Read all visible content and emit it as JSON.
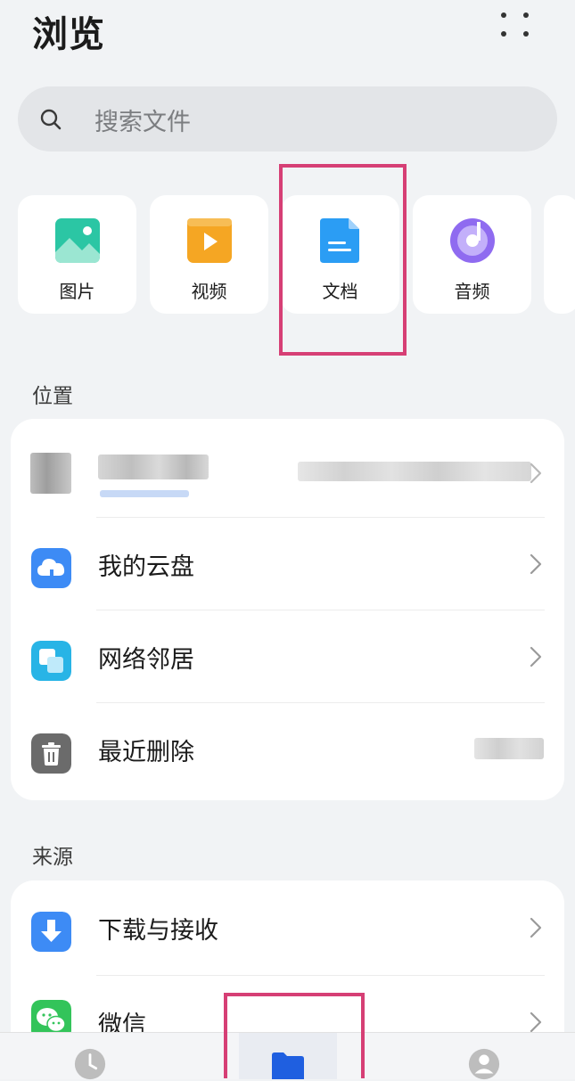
{
  "header": {
    "title": "浏览"
  },
  "search": {
    "placeholder": "搜索文件"
  },
  "categories": [
    {
      "label": "图片",
      "icon": "image-icon",
      "color": "#2bc6a4"
    },
    {
      "label": "视频",
      "icon": "video-icon",
      "color": "#f5a623"
    },
    {
      "label": "文档",
      "icon": "document-icon",
      "color": "#2b9df4"
    },
    {
      "label": "音频",
      "icon": "audio-icon",
      "color": "#8f6bf0"
    }
  ],
  "locations": {
    "title": "位置",
    "items": [
      {
        "label": "我的云盘",
        "icon": "cloud-icon",
        "color": "#3d8bf5"
      },
      {
        "label": "网络邻居",
        "icon": "network-icon",
        "color": "#28b4e6"
      },
      {
        "label": "最近删除",
        "icon": "trash-icon",
        "color": "#6b6b6b"
      }
    ]
  },
  "sources": {
    "title": "来源",
    "items": [
      {
        "label": "下载与接收",
        "icon": "download-icon",
        "color": "#3d8bf5"
      },
      {
        "label": "微信",
        "icon": "wechat-icon",
        "color": "#33c45a"
      }
    ]
  },
  "bottom_nav": [
    {
      "icon": "clock-icon"
    },
    {
      "icon": "folder-icon",
      "active": true,
      "color": "#1f5fe0"
    },
    {
      "icon": "profile-icon"
    }
  ],
  "highlight_color": "#d63f75"
}
